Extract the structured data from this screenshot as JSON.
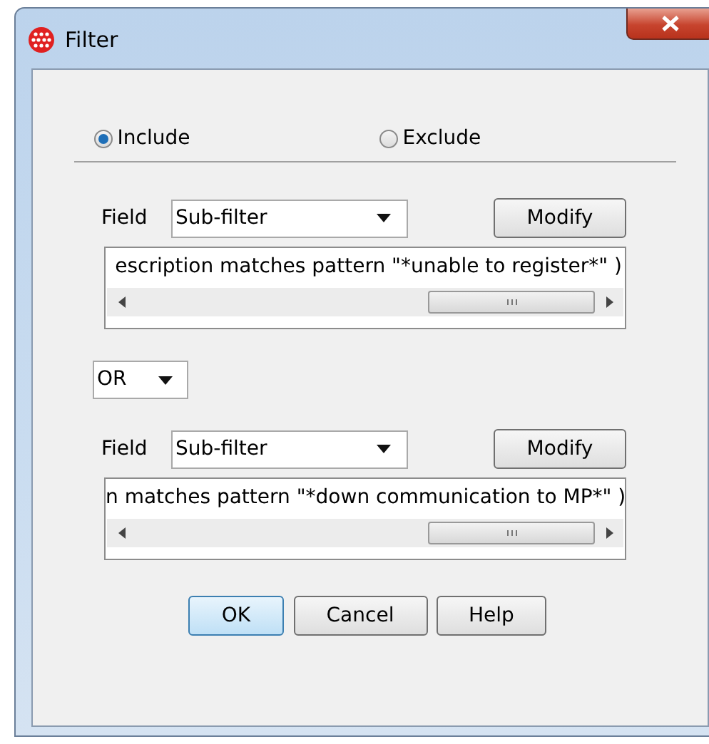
{
  "window": {
    "title": "Filter"
  },
  "mode": [
    {
      "label": "Include",
      "selected": true
    },
    {
      "label": "Exclude",
      "selected": false
    }
  ],
  "conditions": [
    {
      "kind": "filter",
      "field_label": "Field",
      "field_value": "Sub-filter",
      "button": "Modify",
      "expression": "escription matches pattern \"*unable to register*\" )"
    },
    {
      "kind": "operator",
      "value": "OR"
    },
    {
      "kind": "filter",
      "field_label": "Field",
      "field_value": "Sub-filter",
      "button": "Modify",
      "expression": "n matches pattern \"*down communication to MP*\" )"
    }
  ],
  "buttons": [
    {
      "label": "OK",
      "default": true
    },
    {
      "label": "Cancel",
      "default": false
    },
    {
      "label": "Help",
      "default": false
    }
  ]
}
